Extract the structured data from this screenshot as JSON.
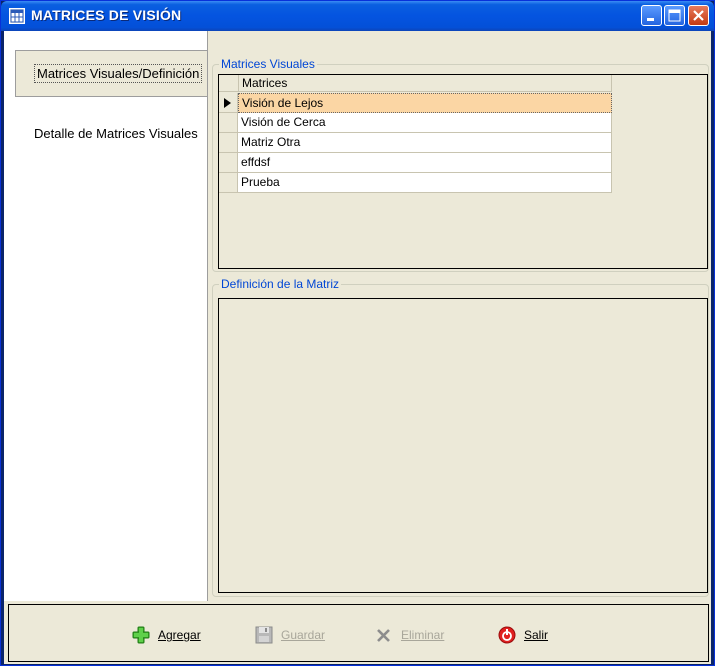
{
  "window": {
    "title": "MATRICES DE VISIÓN",
    "title_icon": "grid-window-icon"
  },
  "tabs": [
    {
      "label": "Matrices Visuales/Definición",
      "active": true
    },
    {
      "label": "Detalle de Matrices Visuales",
      "active": false
    }
  ],
  "matrices_group": {
    "legend": "Matrices Visuales",
    "column_header": "Matrices",
    "rows": [
      {
        "value": "Visión de Lejos",
        "selected": true
      },
      {
        "value": "Visión de Cerca",
        "selected": false
      },
      {
        "value": "Matriz Otra",
        "selected": false
      },
      {
        "value": "effdsf",
        "selected": false
      },
      {
        "value": "Prueba",
        "selected": false
      }
    ]
  },
  "definition_group": {
    "legend": "Definición de la Matriz"
  },
  "toolbar": {
    "add_label": "Agregar",
    "save_label": "Guardar",
    "delete_label": "Eliminar",
    "exit_label": "Salir",
    "save_enabled": false,
    "delete_enabled": false
  },
  "colors": {
    "titlebar": "#0454e0",
    "legend_text": "#0046d5",
    "selected_row": "#fbd6a4",
    "panel_bg": "#ece9d8"
  }
}
